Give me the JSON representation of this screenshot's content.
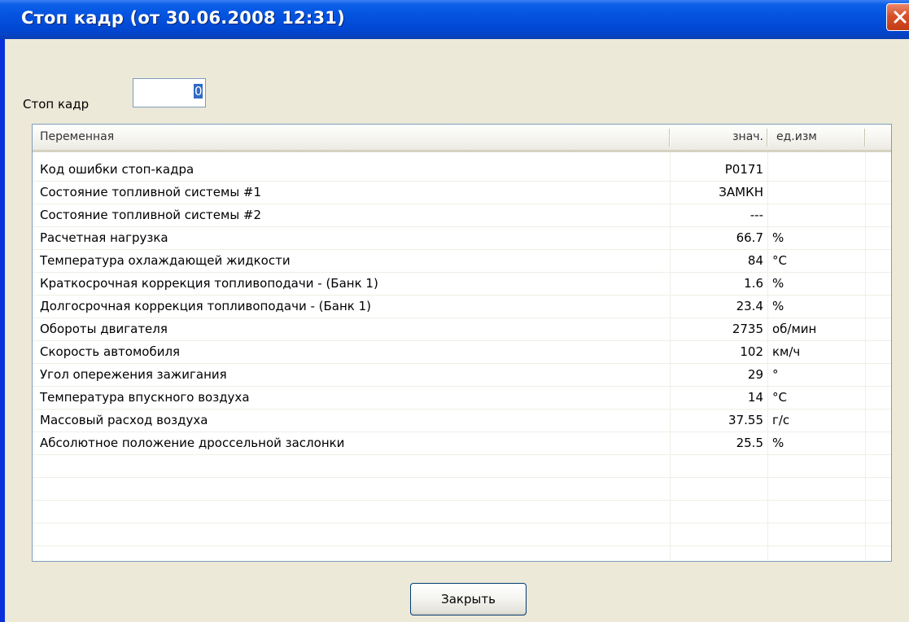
{
  "window": {
    "title": "Стоп кадр (от 30.06.2008  12:31)",
    "close_icon": "close-icon"
  },
  "frame": {
    "label": "Стоп кадр",
    "value": "0"
  },
  "table": {
    "headers": {
      "name": "Переменная",
      "value": "знач.",
      "unit": "ед.изм"
    },
    "rows": [
      {
        "name": "Код ошибки стоп-кадра",
        "value": "P0171",
        "unit": ""
      },
      {
        "name": "Состояние топливной системы #1",
        "value": "ЗАМКН",
        "unit": ""
      },
      {
        "name": "Состояние топливной системы #2",
        "value": "---",
        "unit": ""
      },
      {
        "name": "Расчетная нагрузка",
        "value": "66.7",
        "unit": "%"
      },
      {
        "name": "Температура охлаждающей жидкости",
        "value": "84",
        "unit": "°C"
      },
      {
        "name": "Краткосрочная коррекция топливоподачи - (Банк 1)",
        "value": "1.6",
        "unit": "%"
      },
      {
        "name": "Долгосрочная коррекция топливоподачи -  (Банк 1)",
        "value": "23.4",
        "unit": "%"
      },
      {
        "name": "Обороты двигателя",
        "value": "2735",
        "unit": "об/мин"
      },
      {
        "name": "Скорость автомобиля",
        "value": "102",
        "unit": "км/ч"
      },
      {
        "name": "Угол опережения зажигания",
        "value": "29",
        "unit": "°"
      },
      {
        "name": "Температура впускного воздуха",
        "value": "14",
        "unit": "°C"
      },
      {
        "name": "Массовый расход воздуха",
        "value": "37.55",
        "unit": "г/с"
      },
      {
        "name": "Абсолютное положение дроссельной заслонки",
        "value": "25.5",
        "unit": "%"
      },
      {
        "name": "",
        "value": "",
        "unit": ""
      },
      {
        "name": "",
        "value": "",
        "unit": ""
      },
      {
        "name": "",
        "value": "",
        "unit": ""
      },
      {
        "name": "",
        "value": "",
        "unit": ""
      },
      {
        "name": "",
        "value": "",
        "unit": ""
      }
    ]
  },
  "buttons": {
    "close_label": "Закрыть"
  },
  "colors": {
    "titlebar": "#0453e0",
    "close_button": "#d6502b",
    "selection": "#316ac5"
  }
}
